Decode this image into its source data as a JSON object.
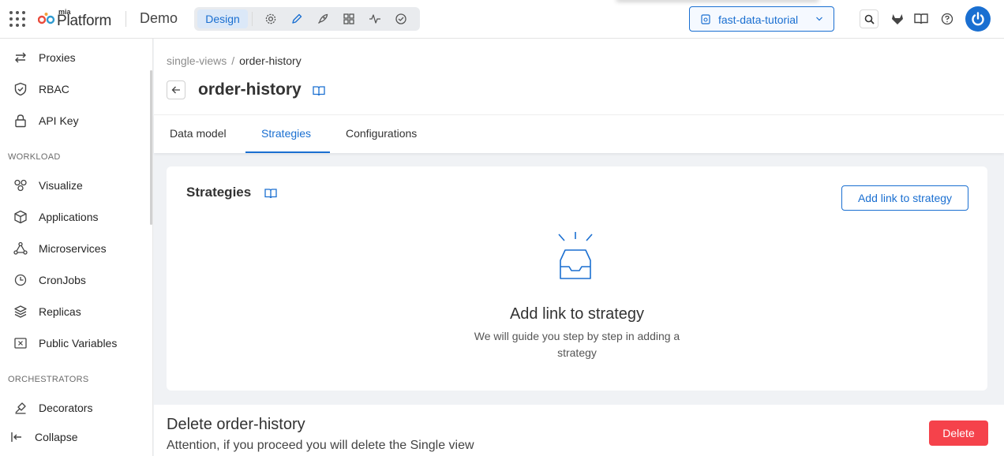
{
  "topbar": {
    "logo_small": "mia",
    "logo_text": "Platform",
    "project_name": "Demo",
    "mode_active": "Design",
    "mode_icons": [
      "settings-icon",
      "pencil-icon",
      "rocket-icon",
      "dashboard-icon",
      "activity-icon",
      "check-circle-icon"
    ],
    "branch_label": "fast-data-tutorial",
    "right_icons": [
      "search-icon",
      "gitlab-icon",
      "book-icon",
      "help-icon",
      "power-avatar-icon"
    ]
  },
  "sidebar": {
    "items_top": [
      {
        "label": "Proxies",
        "icon": "swap-icon"
      },
      {
        "label": "RBAC",
        "icon": "shield-check-icon"
      },
      {
        "label": "API Key",
        "icon": "lock-icon"
      }
    ],
    "section_workload": "WORKLOAD",
    "items_workload": [
      {
        "label": "Visualize",
        "icon": "cluster-icon"
      },
      {
        "label": "Applications",
        "icon": "cube-icon"
      },
      {
        "label": "Microservices",
        "icon": "nodes-icon"
      },
      {
        "label": "CronJobs",
        "icon": "clock-icon"
      },
      {
        "label": "Replicas",
        "icon": "layers-icon"
      },
      {
        "label": "Public Variables",
        "icon": "variable-icon"
      }
    ],
    "section_orchestrators": "ORCHESTRATORS",
    "items_orchestrators": [
      {
        "label": "Decorators",
        "icon": "decorator-icon"
      }
    ],
    "collapse_label": "Collapse"
  },
  "header": {
    "breadcrumb_parent": "single-views",
    "breadcrumb_sep": "/",
    "breadcrumb_current": "order-history",
    "title": "order-history",
    "tabs": [
      {
        "label": "Data model",
        "active": false
      },
      {
        "label": "Strategies",
        "active": true
      },
      {
        "label": "Configurations",
        "active": false
      }
    ]
  },
  "card": {
    "title": "Strategies",
    "add_button": "Add link to strategy",
    "empty_title": "Add link to strategy",
    "empty_description": "We will guide you step by step in adding a strategy"
  },
  "danger": {
    "title": "Delete order-history",
    "description": "Attention, if you proceed you will delete the Single view",
    "button": "Delete"
  },
  "colors": {
    "accent": "#1a6fd1",
    "danger": "#f5424b",
    "background": "#f0f2f5"
  }
}
